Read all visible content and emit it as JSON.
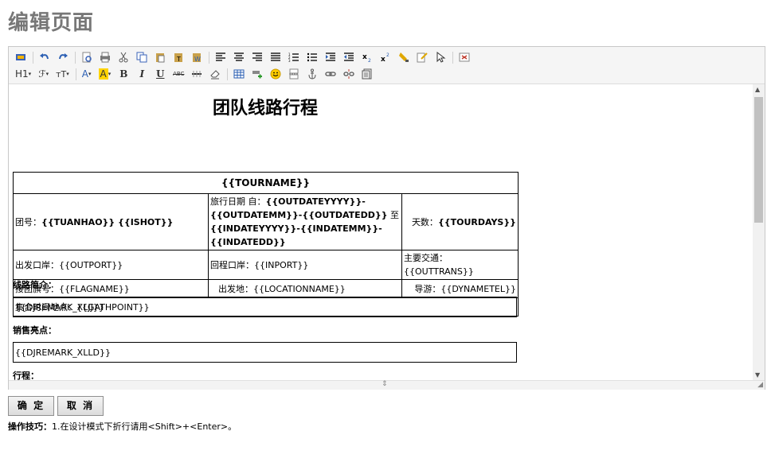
{
  "page": {
    "title": "编辑页面"
  },
  "document": {
    "title": "团队线路行程",
    "tour_name": "{{TOURNAME}}",
    "row1": {
      "group_label": "团号：",
      "group_value": "{{TUANHAO}} {{ISHOT}}",
      "date_prefix": "旅行日期 自：",
      "date_from": "{{OUTDATEYYYY}}-{{OUTDATEMM}}-{{OUTDATEDD}}",
      "date_to_label": " 至 ",
      "date_to": "{{INDATEYYYY}}-{{INDATEMM}}-{{INDATEDD}}",
      "days_label": "天数：",
      "days_value": "{{TOURDAYS}}"
    },
    "row2": {
      "out_port": "出发口岸：{{OUTPORT}}",
      "in_port": "回程口岸：{{INPORT}}",
      "transport": "主要交通：{{OUTTRANS}}"
    },
    "row3": {
      "flag": "接团旗号：{{FLAGNAME}}",
      "location": "出发地：{{LOCATIONNAME}}",
      "guide": "导游：{{DYNAMETEL}}"
    },
    "row4": {
      "gather": "集合时间地点：{{GATHPOINT}}"
    },
    "route_intro_label": "线路简介：",
    "route_intro_value": "{{DJREMARK_XLJJ}}",
    "highlights_label": "销售亮点：",
    "highlights_value": "{{DJREMARK_XLLD}}",
    "itinerary_label": "行程："
  },
  "buttons": {
    "ok": "确 定",
    "cancel": "取 消"
  },
  "tip": {
    "label": "操作技巧：",
    "text": "1.在设计模式下折行请用<Shift>+<Enter>。"
  }
}
